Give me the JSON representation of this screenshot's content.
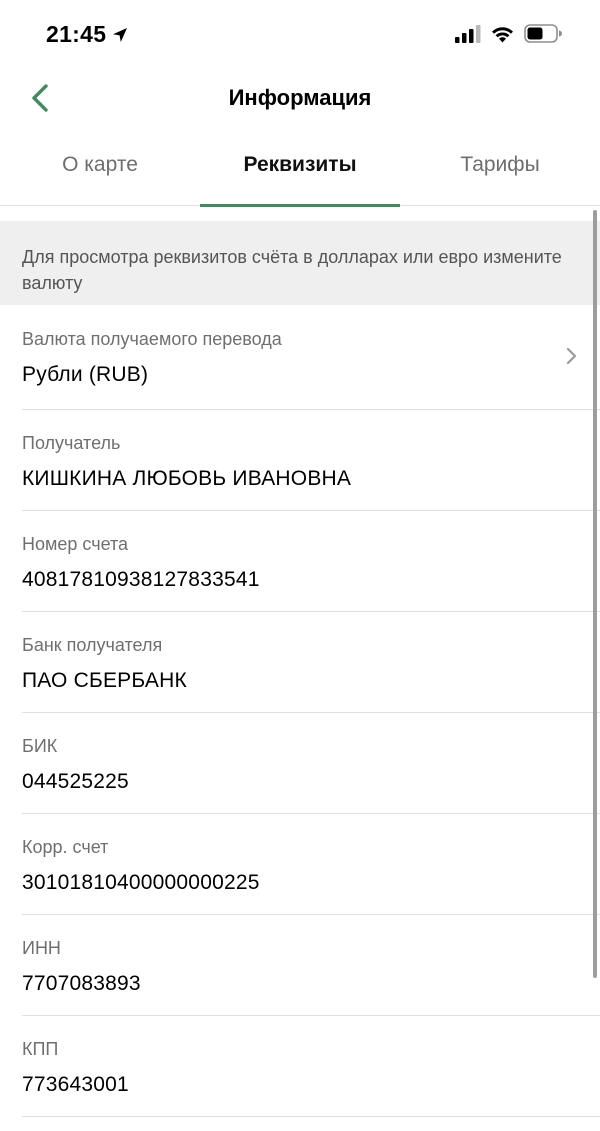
{
  "status_bar": {
    "time": "21:45"
  },
  "nav": {
    "title": "Информация"
  },
  "tabs": [
    {
      "label": "О карте",
      "active": false
    },
    {
      "label": "Реквизиты",
      "active": true
    },
    {
      "label": "Тарифы",
      "active": false
    }
  ],
  "banner": {
    "text": "Для просмотра реквизитов счёта в долларах или евро измените валюту"
  },
  "rows": [
    {
      "label": "Валюта получаемого перевода",
      "value": "Рубли (RUB)"
    },
    {
      "label": "Получатель",
      "value": "КИШКИНА ЛЮБОВЬ ИВАНОВНА"
    },
    {
      "label": "Номер счета",
      "value": "40817810938127833541"
    },
    {
      "label": "Банк получателя",
      "value": "ПАО СБЕРБАНК"
    },
    {
      "label": "БИК",
      "value": "044525225"
    },
    {
      "label": "Корр. счет",
      "value": "30101810400000000225"
    },
    {
      "label": "ИНН",
      "value": "7707083893"
    },
    {
      "label": "КПП",
      "value": "773643001"
    }
  ],
  "icons": {
    "back": "chevron-left-icon",
    "location": "location-arrow-icon",
    "signal": "cellular-signal-icon",
    "wifi": "wifi-icon",
    "battery": "battery-icon",
    "currency_chevron": "chevron-right-icon"
  },
  "colors": {
    "accent": "#3f8d5b",
    "banner_bg": "#efefef",
    "label": "#6f6f6f"
  }
}
